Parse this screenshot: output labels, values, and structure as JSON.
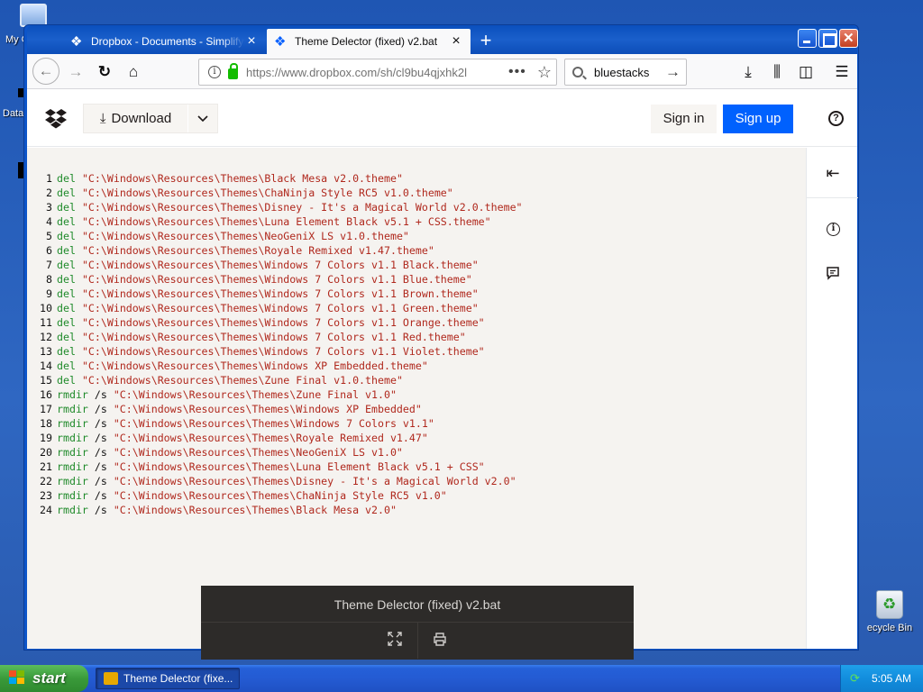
{
  "desktop": {
    "icons": [
      {
        "label": "My C"
      },
      {
        "label": "Data"
      },
      {
        "label": "ecycle Bin"
      }
    ]
  },
  "browser": {
    "tabs": [
      {
        "title": "Dropbox - Documents - Simplify your",
        "active": false
      },
      {
        "title": "Theme Delector (fixed) v2.bat",
        "active": true
      }
    ],
    "url": "https://www.dropbox.com/sh/cl9bu4qjxhk2l",
    "search_value": "bluestacks"
  },
  "dropbox": {
    "download_label": "Download",
    "signin_label": "Sign in",
    "signup_label": "Sign up",
    "accent": "#0061fe"
  },
  "file": {
    "name": "Theme Delector (fixed) v2.bat",
    "lines": [
      {
        "n": "1",
        "cmd": "del",
        "args": "",
        "path": "\"C:\\Windows\\Resources\\Themes\\Black Mesa v2.0.theme\""
      },
      {
        "n": "2",
        "cmd": "del",
        "args": "",
        "path": "\"C:\\Windows\\Resources\\Themes\\ChaNinja Style RC5 v1.0.theme\""
      },
      {
        "n": "3",
        "cmd": "del",
        "args": "",
        "path": "\"C:\\Windows\\Resources\\Themes\\Disney - It's a Magical World v2.0.theme\""
      },
      {
        "n": "4",
        "cmd": "del",
        "args": "",
        "path": "\"C:\\Windows\\Resources\\Themes\\Luna Element Black v5.1 + CSS.theme\""
      },
      {
        "n": "5",
        "cmd": "del",
        "args": "",
        "path": "\"C:\\Windows\\Resources\\Themes\\NeoGeniX LS v1.0.theme\""
      },
      {
        "n": "6",
        "cmd": "del",
        "args": "",
        "path": "\"C:\\Windows\\Resources\\Themes\\Royale Remixed v1.47.theme\""
      },
      {
        "n": "7",
        "cmd": "del",
        "args": "",
        "path": "\"C:\\Windows\\Resources\\Themes\\Windows 7 Colors v1.1 Black.theme\""
      },
      {
        "n": "8",
        "cmd": "del",
        "args": "",
        "path": "\"C:\\Windows\\Resources\\Themes\\Windows 7 Colors v1.1 Blue.theme\""
      },
      {
        "n": "9",
        "cmd": "del",
        "args": "",
        "path": "\"C:\\Windows\\Resources\\Themes\\Windows 7 Colors v1.1 Brown.theme\""
      },
      {
        "n": "10",
        "cmd": "del",
        "args": "",
        "path": "\"C:\\Windows\\Resources\\Themes\\Windows 7 Colors v1.1 Green.theme\""
      },
      {
        "n": "11",
        "cmd": "del",
        "args": "",
        "path": "\"C:\\Windows\\Resources\\Themes\\Windows 7 Colors v1.1 Orange.theme\""
      },
      {
        "n": "12",
        "cmd": "del",
        "args": "",
        "path": "\"C:\\Windows\\Resources\\Themes\\Windows 7 Colors v1.1 Red.theme\""
      },
      {
        "n": "13",
        "cmd": "del",
        "args": "",
        "path": "\"C:\\Windows\\Resources\\Themes\\Windows 7 Colors v1.1 Violet.theme\""
      },
      {
        "n": "14",
        "cmd": "del",
        "args": "",
        "path": "\"C:\\Windows\\Resources\\Themes\\Windows XP Embedded.theme\""
      },
      {
        "n": "15",
        "cmd": "del",
        "args": "",
        "path": "\"C:\\Windows\\Resources\\Themes\\Zune Final v1.0.theme\""
      },
      {
        "n": "16",
        "cmd": "rmdir",
        "args": " /s ",
        "path": "\"C:\\Windows\\Resources\\Themes\\Zune Final v1.0\""
      },
      {
        "n": "17",
        "cmd": "rmdir",
        "args": " /s ",
        "path": "\"C:\\Windows\\Resources\\Themes\\Windows XP Embedded\""
      },
      {
        "n": "18",
        "cmd": "rmdir",
        "args": " /s ",
        "path": "\"C:\\Windows\\Resources\\Themes\\Windows 7 Colors v1.1\""
      },
      {
        "n": "19",
        "cmd": "rmdir",
        "args": " /s ",
        "path": "\"C:\\Windows\\Resources\\Themes\\Royale Remixed v1.47\""
      },
      {
        "n": "20",
        "cmd": "rmdir",
        "args": " /s ",
        "path": "\"C:\\Windows\\Resources\\Themes\\NeoGeniX LS v1.0\""
      },
      {
        "n": "21",
        "cmd": "rmdir",
        "args": " /s ",
        "path": "\"C:\\Windows\\Resources\\Themes\\Luna Element Black v5.1 + CSS\""
      },
      {
        "n": "22",
        "cmd": "rmdir",
        "args": " /s ",
        "path": "\"C:\\Windows\\Resources\\Themes\\Disney - It's a Magical World v2.0\""
      },
      {
        "n": "23",
        "cmd": "rmdir",
        "args": " /s ",
        "path": "\"C:\\Windows\\Resources\\Themes\\ChaNinja Style RC5 v1.0\""
      },
      {
        "n": "24",
        "cmd": "rmdir",
        "args": " /s ",
        "path": "\"C:\\Windows\\Resources\\Themes\\Black Mesa v2.0\""
      }
    ]
  },
  "taskbar": {
    "start_label": "start",
    "task_label": "Theme Delector (fixe...",
    "clock": "5:05 AM"
  }
}
